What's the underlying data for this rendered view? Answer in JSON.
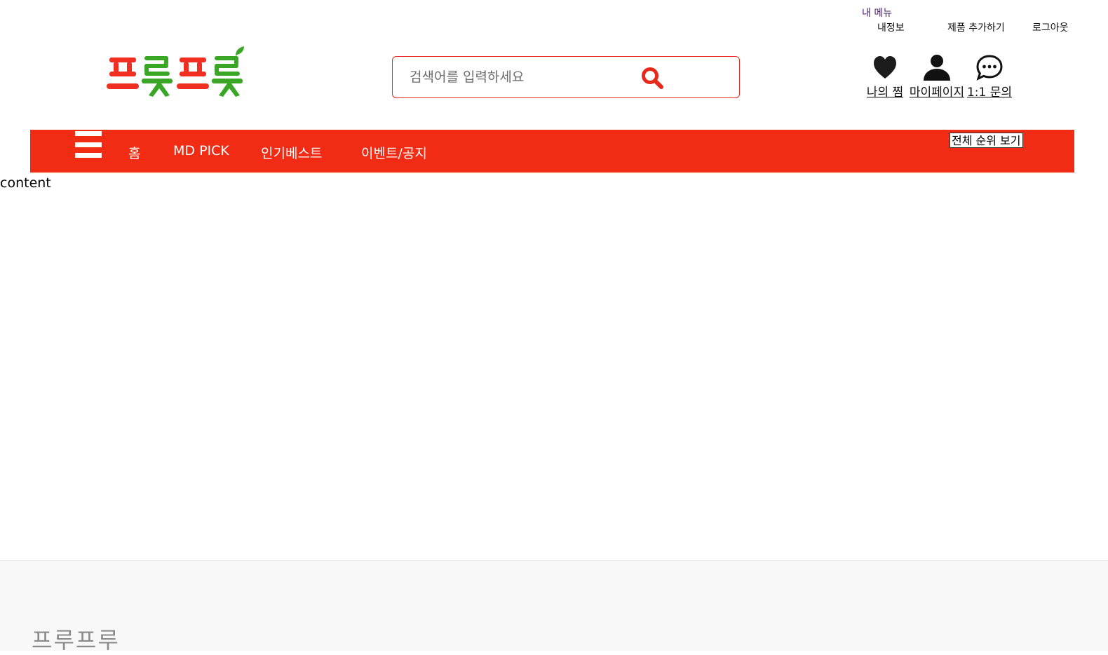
{
  "header": {
    "my_menu_label": "내 메뉴",
    "top_links": {
      "my_info": "내정보",
      "add_product": "제품 추가하기",
      "logout": "로그아웃"
    },
    "logo_text": "프룻프룻",
    "search": {
      "placeholder": "검색어를 입력하세요",
      "value": ""
    },
    "quick_links": {
      "wishlist": "나의 찜",
      "mypage": "마이페이지",
      "inquiry": "1:1 문의"
    }
  },
  "nav": {
    "items": [
      {
        "label": "홈"
      },
      {
        "label": "MD PICK"
      },
      {
        "label": "인기베스트"
      },
      {
        "label": "이벤트/공지"
      }
    ],
    "rank_button": "전체 순위 보기"
  },
  "main": {
    "content_text": "content"
  },
  "footer": {
    "brand": "프루프루"
  },
  "colors": {
    "accent": "#f12b14",
    "search_border": "#e8291a",
    "logo_red": "#f02f22",
    "logo_green": "#3aa626",
    "footer_bg": "#f8f8f8"
  },
  "icons": {
    "search": "search-icon",
    "wishlist": "heart-icon",
    "mypage": "user-icon",
    "inquiry": "chat-bubble-icon",
    "menu": "hamburger-icon"
  }
}
